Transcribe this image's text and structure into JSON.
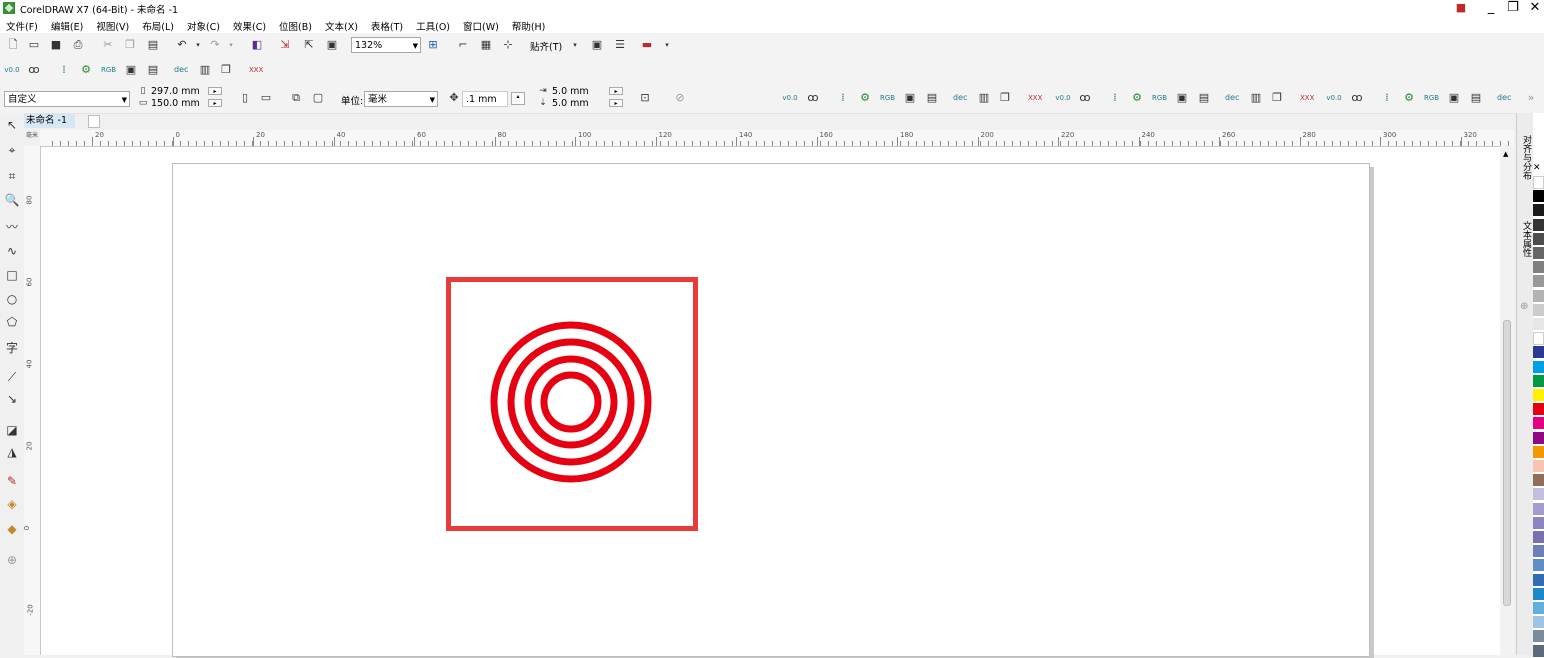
{
  "window": {
    "title": "CorelDRAW X7 (64-Bit) - 未命名 -1",
    "minimize": "_",
    "restore": "❐",
    "close": "✕"
  },
  "menu": [
    "文件(F)",
    "编辑(E)",
    "视图(V)",
    "布局(L)",
    "对象(C)",
    "效果(C)",
    "位图(B)",
    "文本(X)",
    "表格(T)",
    "工具(O)",
    "窗口(W)",
    "帮助(H)"
  ],
  "toolbar": {
    "zoom": "132%",
    "snap_label": "贴齐(T)"
  },
  "propbar": {
    "page_preset": "自定义",
    "page_width": "297.0 mm",
    "page_height": "150.0 mm",
    "units_label": "单位:",
    "units": "毫米",
    "nudge": ".1 mm",
    "dup_x": "5.0 mm",
    "dup_y": "5.0 mm"
  },
  "document_tab": "未命名 -1",
  "ruler": {
    "h_labels": [
      "20",
      "0",
      "20",
      "40",
      "60",
      "80",
      "100",
      "120",
      "140",
      "160",
      "180",
      "200",
      "220",
      "240",
      "260",
      "280",
      "300",
      "320"
    ],
    "v_labels": [
      "80",
      "60",
      "40",
      "20",
      "0",
      "-20"
    ],
    "corner": "毫米"
  },
  "dockers": [
    "对齐与分布",
    "文本属性"
  ],
  "palette": [
    "#ffffff",
    "#000000",
    "#1a1a1a",
    "#333333",
    "#4d4d4d",
    "#666666",
    "#808080",
    "#999999",
    "#b3b3b3",
    "#cccccc",
    "#e6e6e6",
    "#ffffff",
    "#2b3990",
    "#00a0e9",
    "#009944",
    "#fff100",
    "#e60012",
    "#e4007f",
    "#920783",
    "#f39800",
    "#f8c4b0",
    "#8f6e5a",
    "#c3bfdc",
    "#a39ccc",
    "#8c86bf",
    "#7771b0",
    "#6b7fb9",
    "#5f8dc4",
    "#2f6cb3",
    "#1d88c9",
    "#64aedc",
    "#9fc4e3",
    "#7a8b9b",
    "#5b6b7b"
  ],
  "artwork": {
    "frame_color": "#e83b3b",
    "ring_color": "#e60012"
  }
}
